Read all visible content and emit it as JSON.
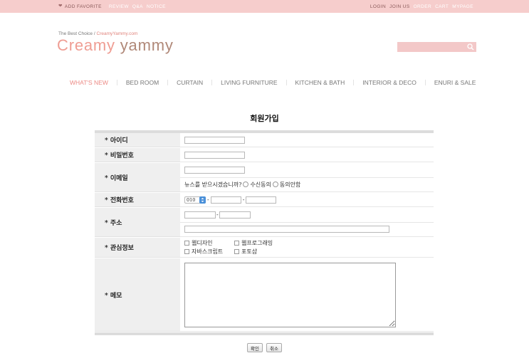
{
  "topbar": {
    "add_favorite": "ADD FAVORITE",
    "review": "REVIEW",
    "qna": "Q&A",
    "notice": "NOTICE",
    "login": "LOGIN",
    "join_us": "JOIN US",
    "order": "ORDER",
    "cart": "CART",
    "mypage": "MYPAGE"
  },
  "header": {
    "tagline": "The Best Choice",
    "tagline_sep": "/",
    "tagline_url": "CreamyYammy.com",
    "logo_word1": "Creamy",
    "logo_word2": "yammy"
  },
  "nav": {
    "items": [
      "WHAT'S NEW",
      "BED ROOM",
      "CURTAIN",
      "LIVING FURNITURE",
      "KITCHEN & BATH",
      "INTERIOR & DECO",
      "ENURI & SALE"
    ]
  },
  "form": {
    "title": "회원가입",
    "labels": {
      "id": "* 아이디",
      "password": "* 비밀번호",
      "email": "* 이메일",
      "phone": "* 전화번호",
      "address": "* 주소",
      "interest": "* 관심정보",
      "memo": "* 메모"
    },
    "newsletter_question": "뉴스를 받으시겠습니까?",
    "newsletter_yes": "수신동의",
    "newsletter_no": "동의안함",
    "phone_prefix": "010",
    "dash": "-",
    "interests": [
      "웹디자인",
      "웹프로그래밍",
      "자바스크립트",
      "포토샵"
    ]
  },
  "buttons": {
    "confirm": "확인",
    "cancel": "취소"
  },
  "colors": {
    "topbar_bg": "#f6cdcc",
    "accent_pink": "#ec8a85",
    "logo_brown": "#b08878"
  }
}
